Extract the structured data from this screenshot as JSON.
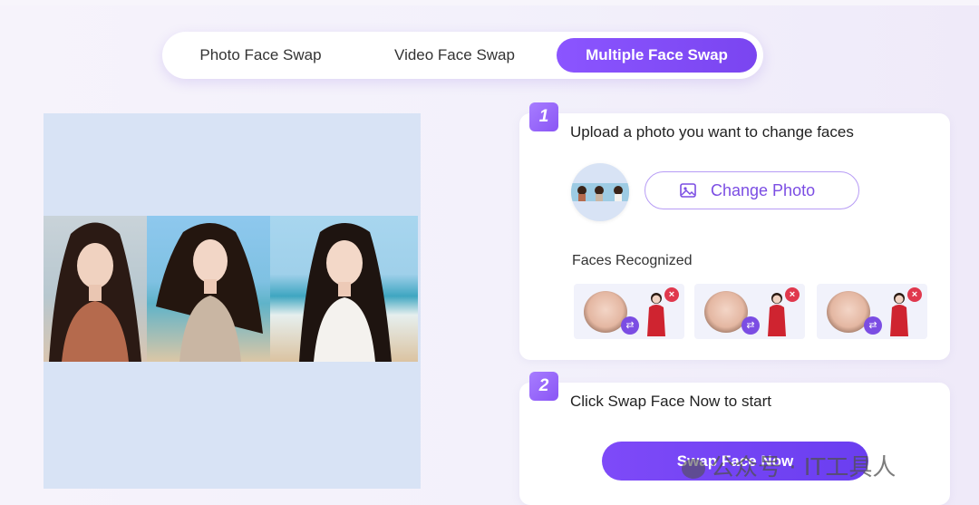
{
  "tabs": [
    {
      "label": "Photo Face Swap",
      "active": false
    },
    {
      "label": "Video Face Swap",
      "active": false
    },
    {
      "label": "Multiple Face Swap",
      "active": true
    }
  ],
  "step1": {
    "number": "1",
    "title": "Upload a photo you want to change faces",
    "change_photo_label": "Change Photo",
    "faces_title": "Faces Recognized",
    "faces": [
      {
        "face": "face-1"
      },
      {
        "face": "face-2"
      },
      {
        "face": "face-3"
      }
    ]
  },
  "step2": {
    "number": "2",
    "title": "Click Swap Face Now to start",
    "button_label": "Swap Face Now"
  },
  "watermark": "公众号 · IT工具人",
  "colors": {
    "accent": "#7b4de3",
    "preview_bg": "#d8e3f5",
    "remove": "#e0384d"
  }
}
